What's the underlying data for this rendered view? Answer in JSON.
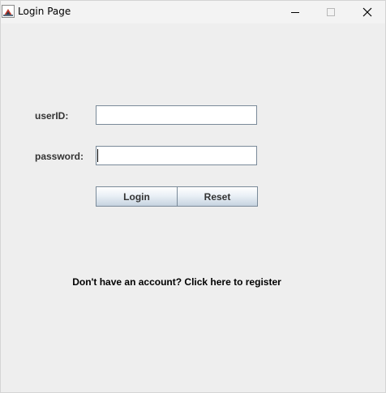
{
  "window": {
    "title": "Login Page",
    "controls": {
      "minimize_icon": "minimize-icon",
      "maximize_icon": "maximize-icon",
      "close_icon": "close-icon"
    }
  },
  "form": {
    "userid_label": "userID:",
    "userid_value": "",
    "password_label": "password:",
    "password_value": "",
    "login_label": "Login",
    "reset_label": "Reset"
  },
  "register": {
    "link_text": "Don't have an account? Click here to register"
  },
  "colors": {
    "background": "#eeeeee",
    "titlebar": "#f3f3f3",
    "field_border": "#7a8a99",
    "label_text": "#333333"
  }
}
